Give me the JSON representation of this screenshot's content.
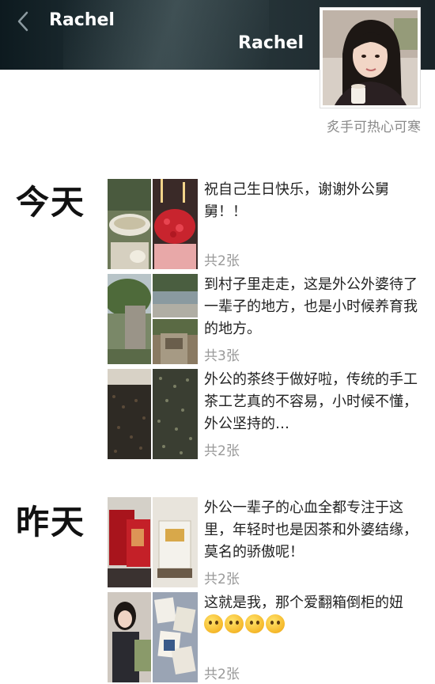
{
  "header": {
    "nav_title": "Rachel",
    "cover_name": "Rachel",
    "signature": "炙手可热心可寒"
  },
  "icons": {
    "back": "chevron-left-icon",
    "avatar": "profile-photo",
    "emoji": "grinning-face-icon"
  },
  "days": [
    {
      "label": "今天",
      "posts": [
        {
          "text": "祝自己生日快乐，谢谢外公舅舅！！",
          "count": "共2张"
        },
        {
          "text": "到村子里走走，这是外公外婆待了一辈子的地方，也是小时候养育我的地方。",
          "count": "共3张"
        },
        {
          "text": "外公的茶终于做好啦，传统的手工茶工艺真的不容易，小时候不懂，外公坚持的…",
          "count": "共2张"
        }
      ]
    },
    {
      "label": "昨天",
      "posts": [
        {
          "text": "外公一辈子的心血全都专注于这里，年轻时也是因茶和外婆结缘，莫名的骄傲呢！",
          "count": "共2张"
        },
        {
          "text": "这就是我，那个爱翻箱倒柜的妞",
          "count": "共2张"
        }
      ]
    }
  ]
}
